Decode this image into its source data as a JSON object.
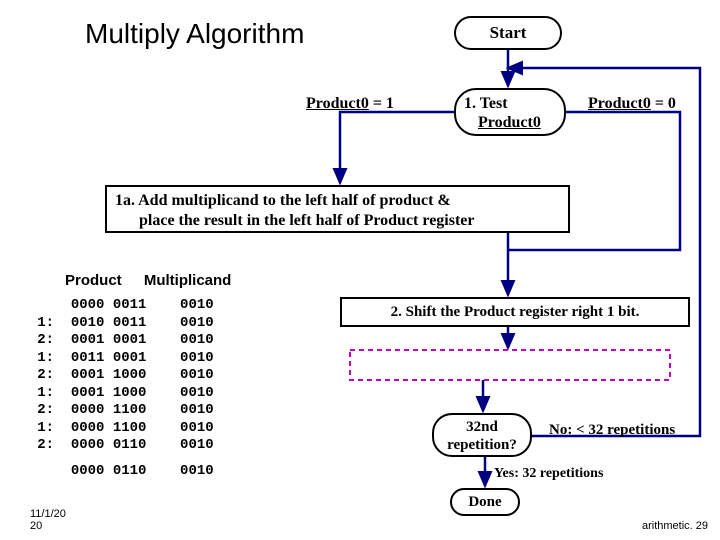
{
  "title": "Multiply Algorithm",
  "flowchart": {
    "start": "Start",
    "test_line1": "1. Test",
    "test_line2": "Product0",
    "branch_left_a": "Product0",
    "branch_left_b": " = 1",
    "branch_right_a": "Product0",
    "branch_right_b": " = 0",
    "box_1a_l1": "1a. Add multiplicand to the left half of product &",
    "box_1a_l2": "      place the result in the left half of Product register",
    "box_2": "2. Shift the Product register right 1 bit.",
    "rep_l1": "32nd",
    "rep_l2": "repetition?",
    "no_label": "No: < 32 repetitions",
    "yes_label": "Yes: 32 repetitions",
    "done": "Done"
  },
  "table": {
    "header_product": "Product",
    "header_multiplicand": "Multiplicand",
    "rows": [
      {
        "step": "",
        "product": "0000 0011",
        "mcand": "0010"
      },
      {
        "step": "1:",
        "product": "0010 0011",
        "mcand": "0010"
      },
      {
        "step": "2:",
        "product": "0001 0001",
        "mcand": "0010"
      },
      {
        "step": "1:",
        "product": "0011 0001",
        "mcand": "0010"
      },
      {
        "step": "2:",
        "product": "0001 1000",
        "mcand": "0010"
      },
      {
        "step": "1:",
        "product": "0001 1000",
        "mcand": "0010"
      },
      {
        "step": "2:",
        "product": "0000 1100",
        "mcand": "0010"
      },
      {
        "step": "1:",
        "product": "0000 1100",
        "mcand": "0010"
      },
      {
        "step": "2:",
        "product": "0000 0110",
        "mcand": "0010"
      }
    ],
    "final": {
      "step": "",
      "product": "0000 0110",
      "mcand": "0010"
    }
  },
  "footer": {
    "date": "11/1/20\n20",
    "pageref": "arithmetic. 29"
  }
}
